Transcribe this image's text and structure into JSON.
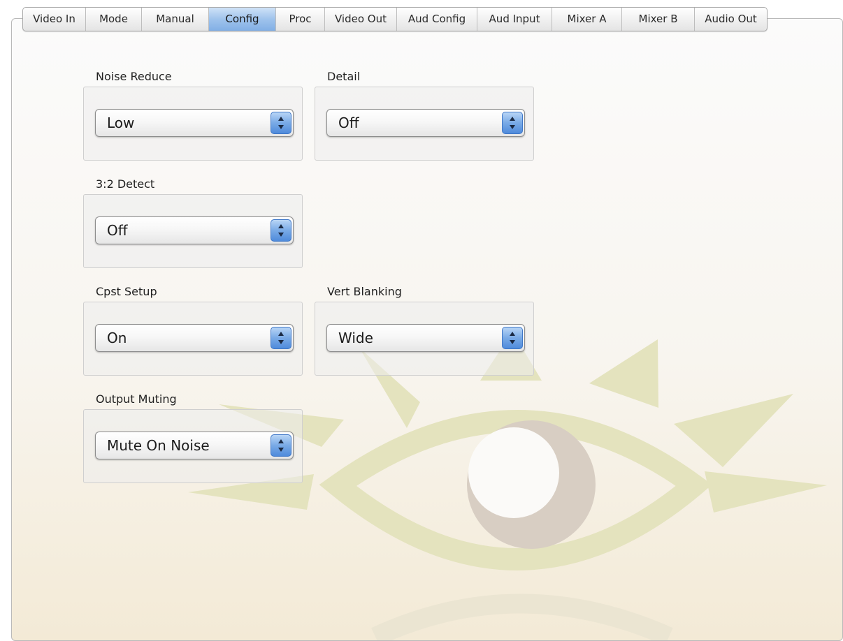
{
  "tabs": [
    {
      "label": "Video In"
    },
    {
      "label": "Mode"
    },
    {
      "label": "Manual"
    },
    {
      "label": "Config"
    },
    {
      "label": "Proc"
    },
    {
      "label": "Video Out"
    },
    {
      "label": "Aud Config"
    },
    {
      "label": "Aud Input"
    },
    {
      "label": "Mixer A"
    },
    {
      "label": "Mixer B"
    },
    {
      "label": "Audio Out"
    }
  ],
  "active_tab": "Config",
  "controls": {
    "noise_reduce": {
      "label": "Noise Reduce",
      "value": "Low"
    },
    "detail": {
      "label": "Detail",
      "value": "Off"
    },
    "detect_32": {
      "label": "3:2 Detect",
      "value": "Off"
    },
    "cpst_setup": {
      "label": "Cpst Setup",
      "value": "On"
    },
    "vert_blanking": {
      "label": "Vert Blanking",
      "value": "Wide"
    },
    "output_muting": {
      "label": "Output Muting",
      "value": "Mute On Noise"
    }
  },
  "icons": {
    "select_stepper": "up-down-arrows-icon",
    "watermark": "eye-logo-icon"
  },
  "colors": {
    "accent": "#82afe5",
    "watermark_green": "#e3e2bc",
    "watermark_iris": "#dad1c6"
  }
}
